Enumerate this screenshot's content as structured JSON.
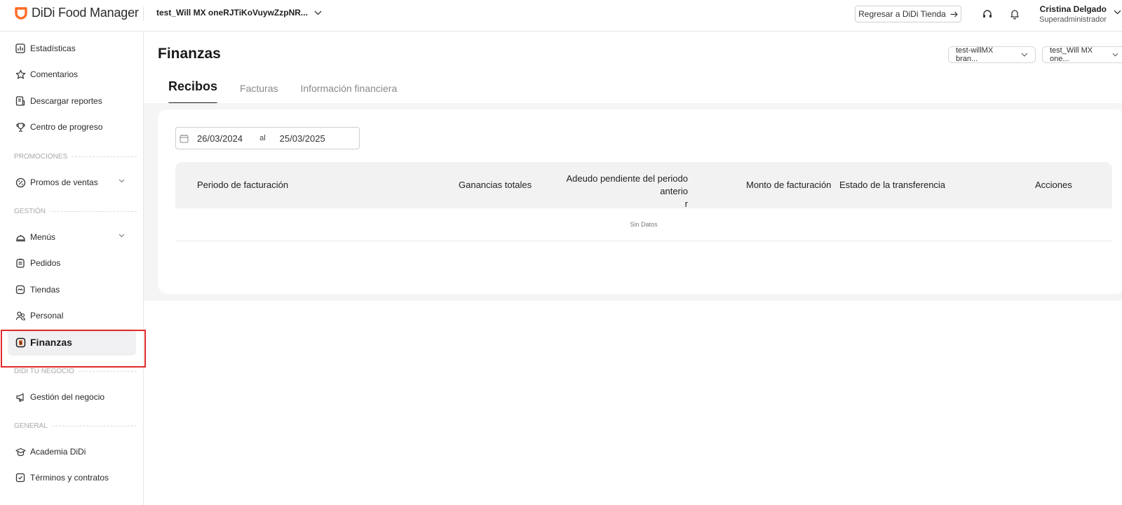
{
  "header": {
    "logo_text": "DiDi Food Manager",
    "store_name": "test_Will MX oneRJTiKoVuywZzpNR...",
    "back_button": "Regresar a DiDi Tienda",
    "user_name": "Cristina Delgado",
    "user_role": "Superadministrador",
    "brand_color": "#fc6d25"
  },
  "sidebar": {
    "items_top": [
      {
        "label": "Estadísticas",
        "icon": "chart-icon"
      },
      {
        "label": "Comentarios",
        "icon": "star-icon"
      },
      {
        "label": "Descargar reportes",
        "icon": "report-icon"
      },
      {
        "label": "Centro de progreso",
        "icon": "trophy-icon"
      }
    ],
    "section_promos": "PROMOCIONES",
    "promos_item": "Promos de ventas",
    "section_gestion": "GESTIÓN",
    "gestion_items": [
      {
        "label": "Menús",
        "icon": "cloche-icon"
      },
      {
        "label": "Pedidos",
        "icon": "clipboard-icon"
      },
      {
        "label": "Tiendas",
        "icon": "store-icon"
      },
      {
        "label": "Personal",
        "icon": "people-icon"
      },
      {
        "label": "Finanzas",
        "icon": "dollar-icon"
      }
    ],
    "section_negocio": "DIDI TU NEGOCIO",
    "negocio_item": "Gestión del negocio",
    "section_general": "GENERAL",
    "general_items": [
      {
        "label": "Academia DiDi",
        "icon": "graduation-cap-icon"
      },
      {
        "label": "Términos y contratos",
        "icon": "contract-icon"
      }
    ]
  },
  "main": {
    "title": "Finanzas",
    "filters": [
      "test-willMX bran...",
      "test_Will MX one..."
    ],
    "tabs": [
      "Recibos",
      "Facturas",
      "Información financiera"
    ],
    "date_from": "26/03/2024",
    "date_sep": "al",
    "date_to": "25/03/2025",
    "table": {
      "headers": [
        "Periodo de facturación",
        "Ganancias totales",
        "Adeudo pendiente del periodo anterio",
        "r",
        "Monto de facturación",
        "Estado de la transferencia",
        "Acciones"
      ],
      "empty_text": "Sin Datos"
    }
  }
}
